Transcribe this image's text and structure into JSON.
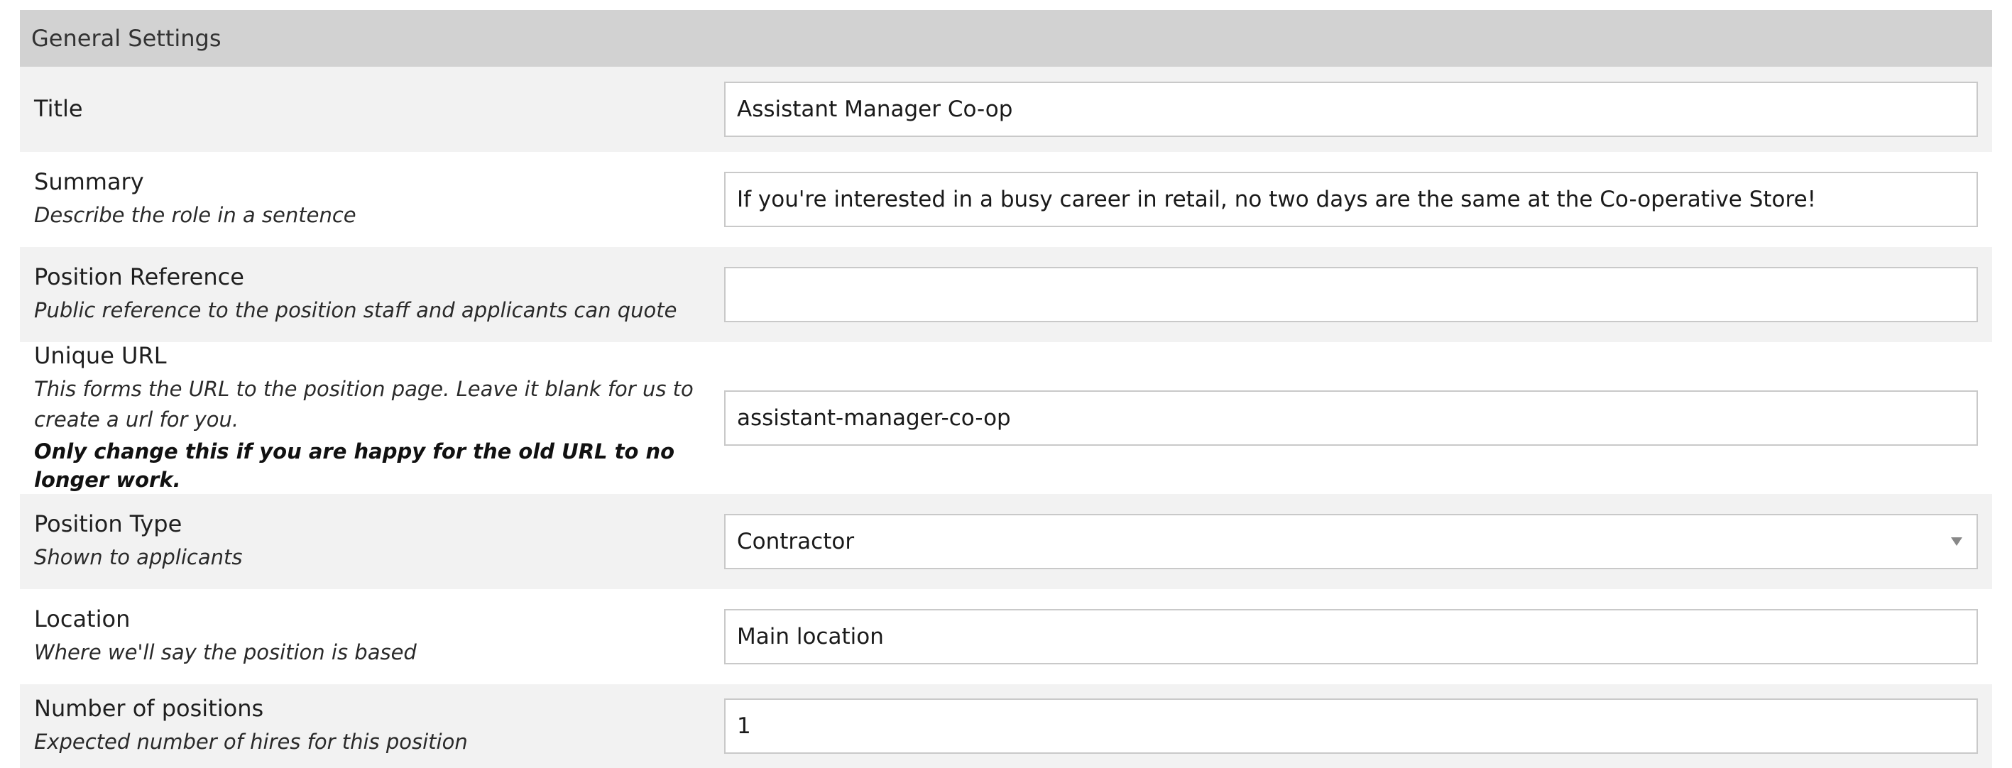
{
  "panel": {
    "title": "General Settings"
  },
  "fields": {
    "title": {
      "label": "Title",
      "value": "Assistant Manager Co-op"
    },
    "summary": {
      "label": "Summary",
      "help": "Describe the role in a sentence",
      "value": "If you're interested in a busy career in retail, no two days are the same at the Co-operative Store!"
    },
    "position_reference": {
      "label": "Position Reference",
      "help": "Public reference to the position staff and applicants can quote",
      "value": ""
    },
    "unique_url": {
      "label": "Unique URL",
      "help": "This forms the URL to the position page. Leave it blank for us to create a url for you.",
      "warning": "Only change this if you are happy for the old URL to no longer work.",
      "value": "assistant-manager-co-op"
    },
    "position_type": {
      "label": "Position Type",
      "help": "Shown to applicants",
      "selected": "Contractor",
      "icon": "chevron-down-icon"
    },
    "location": {
      "label": "Location",
      "help": "Where we'll say the position is based",
      "value": "Main location"
    },
    "number_of_positions": {
      "label": "Number of positions",
      "help": "Expected number of hires for this position",
      "value": "1"
    }
  },
  "colors": {
    "header_bg": "#d2d2d2",
    "row_shaded": "#f2f2f2",
    "row_plain": "#ffffff",
    "input_border": "#c9c9c9"
  }
}
